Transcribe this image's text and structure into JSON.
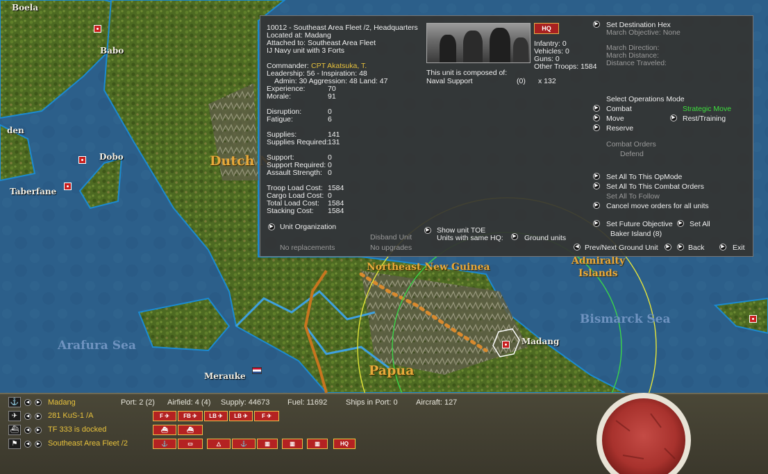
{
  "map": {
    "bases": [
      {
        "name": "Boela"
      },
      {
        "name": "Babo"
      },
      {
        "name": "den"
      },
      {
        "name": "Dobo"
      },
      {
        "name": "Taberfane"
      },
      {
        "name": "Merauke"
      },
      {
        "name": "Madang"
      }
    ],
    "regions": [
      "Dutch N",
      "Northeast New Guinea",
      "Papua",
      "Admiralty",
      "Islands"
    ],
    "seas": [
      "Arafura Sea",
      "Bismarck Sea"
    ]
  },
  "panel": {
    "header": {
      "unit_title": "10012 - Southeast Area Fleet /2, Headquarters",
      "located": "Located at: Madang",
      "attached": "Attached to: Southeast Area Fleet",
      "type": "IJ Navy unit with 3 Forts"
    },
    "commander_label": "Commander:",
    "commander": "CPT Akatsuka, T.",
    "leadership": "Leadership: 56 - Inspiration: 48",
    "admin_line": "Admin: 30  Aggression: 48  Land: 47",
    "stats": [
      {
        "label": "Experience:",
        "value": "70"
      },
      {
        "label": "Morale:",
        "value": "91"
      },
      {
        "label": "Disruption:",
        "value": "0"
      },
      {
        "label": "Fatigue:",
        "value": "6"
      },
      {
        "label": "Supplies:",
        "value": "141"
      },
      {
        "label": "Supplies Required:",
        "value": "131"
      },
      {
        "label": "Support:",
        "value": "0"
      },
      {
        "label": "Support Required:",
        "value": "0"
      },
      {
        "label": "Assault Strength:",
        "value": "0"
      },
      {
        "label": "Troop Load Cost:",
        "value": "1584"
      },
      {
        "label": "Cargo Load Cost:",
        "value": "0"
      },
      {
        "label": "Total Load Cost:",
        "value": "1584"
      },
      {
        "label": "Stacking Cost:",
        "value": "1584"
      }
    ],
    "hq_badge": "HQ",
    "troops": {
      "infantry": "Infantry: 0",
      "vehicles": "Vehicles: 0",
      "guns": "Guns: 0",
      "other": "Other Troops: 1584"
    },
    "composed_label": "This unit is composed of:",
    "composed_item": {
      "name": "Naval Support",
      "count": "(0)",
      "qty": "x 132"
    },
    "unit_organization": "Unit Organization",
    "disband_unit": "Disband Unit",
    "no_replacements": "No replacements",
    "no_upgrades": "No upgrades",
    "show_toe": "Show unit TOE",
    "units_same_hq": "Units with same HQ:",
    "ground_units": "Ground units",
    "destination": {
      "set_destination": "Set Destination Hex",
      "march_objective": "March Objective: None",
      "march_direction": "March Direction:",
      "march_distance": "March Distance:",
      "distance_traveled": "Distance Traveled:"
    },
    "ops": {
      "title": "Select Operations Mode",
      "combat": "Combat",
      "strategic_move": "Strategic Move",
      "move": "Move",
      "rest_training": "Rest/Training",
      "reserve": "Reserve",
      "combat_orders": "Combat Orders",
      "defend": "Defend"
    },
    "actions": {
      "set_all_opmode": "Set All To This OpMode",
      "set_all_combat": "Set All To This Combat Orders",
      "set_all_follow": "Set All To Follow",
      "cancel_move": "Cancel move orders for all units",
      "set_future": "Set Future Objective",
      "set_all": "Set All",
      "future_target": "Baker Island (8)",
      "prev_next": "Prev/Next Ground Unit",
      "back": "Back",
      "exit": "Exit"
    }
  },
  "bottom": {
    "base_name": "Madang",
    "port": "Port: 2 (2)",
    "airfield": "Airfield: 4 (4)",
    "supply": "Supply: 44673",
    "fuel": "Fuel: 11692",
    "ships": "Ships in Port: 0",
    "aircraft": "Aircraft: 127",
    "air_unit": "281 KuS-1 /A",
    "task_force": "TF 333 is docked",
    "ground_unit": "Southeast Area Fleet /2",
    "air_chips": [
      "F",
      "FB",
      "LB",
      "LB",
      "F"
    ],
    "hq_chip": "HQ"
  },
  "colors": {
    "panel_bg": "#343432",
    "accent_yellow": "#e8c23c",
    "accent_green": "#3ee03e",
    "japan_red": "#c81e1e"
  }
}
